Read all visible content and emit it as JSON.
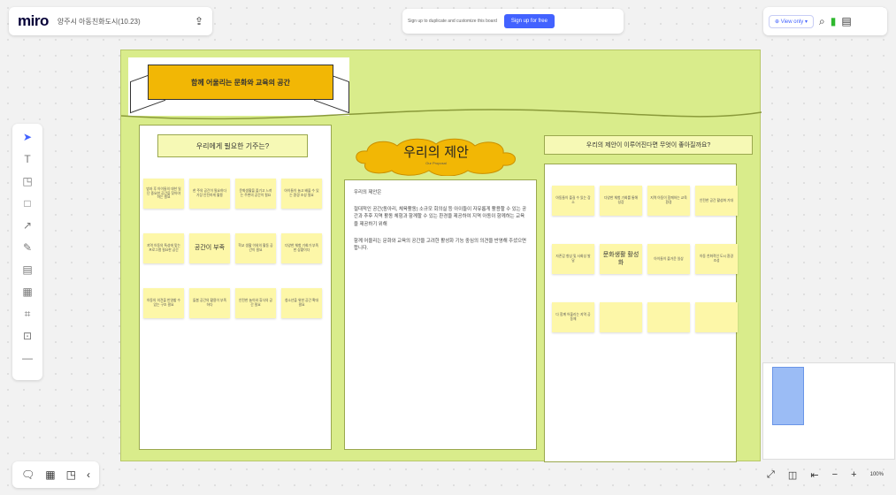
{
  "app": {
    "logo": "miro",
    "board_title": "양주시 아동친화도시(10.23)",
    "upload_icon": "upload-icon"
  },
  "signup": {
    "text": "Sign up to duplicate and customize this board",
    "button": "Sign up for free"
  },
  "top_right": {
    "view_only": "View only",
    "icons": [
      "search-icon",
      "timer-icon",
      "notes-icon"
    ]
  },
  "toolbar": {
    "tools": [
      {
        "name": "select-tool",
        "glyph": "➤",
        "active": true
      },
      {
        "name": "text-tool",
        "glyph": "T",
        "active": false
      },
      {
        "name": "sticky-note-tool",
        "glyph": "◳",
        "active": false
      },
      {
        "name": "shape-tool",
        "glyph": "□",
        "active": false
      },
      {
        "name": "connection-line-tool",
        "glyph": "↗",
        "active": false
      },
      {
        "name": "pen-tool",
        "glyph": "✎",
        "active": false
      },
      {
        "name": "comment-tool",
        "glyph": "▤",
        "active": false
      },
      {
        "name": "template-tool",
        "glyph": "▦",
        "active": false
      },
      {
        "name": "frame-tool",
        "glyph": "⌗",
        "active": false
      },
      {
        "name": "upload-tool",
        "glyph": "⊡",
        "active": false
      },
      {
        "name": "more-tools",
        "glyph": "—",
        "active": false
      }
    ]
  },
  "bottom_left": {
    "icons": [
      "comments-icon",
      "grid-icon",
      "sticky-icon",
      "chevron-icon"
    ],
    "glyphs": [
      "🗨",
      "▦",
      "◳",
      "‹"
    ]
  },
  "bottom_right": {
    "fit_icon": "expand-icon",
    "minimap_icon": "minimap-icon",
    "zoom_out": "−",
    "zoom_in": "+",
    "zoom_level": "100%"
  },
  "board": {
    "banner": "함께 어울리는 문화와 교육의 공간",
    "col1_title": "우리에게 필요한 기주는?",
    "col1_stickies": [
      "방과 후 아이들의 대한 일단 중요한 공간을 찾아야 하는 필요",
      "한 주의 공간이 필요하다 가장 안전하게 활용",
      "문화생활을 즐기고 느끼는 주변의 공간이 필요",
      "아이들이 놀고 배울 수 있는 환경 조성 필요",
      "지역 아동의 특성에 맞는 프로그램 필요한 공간",
      "공간이 부족",
      "학교 생활 이외의 활동 공간이 필요",
      "다양한 체험 기회가 부족한 상황이다",
      "아동의 의견을 반영할 수 있는 구조 필요",
      "돌봄 공간의 활용이 부족하다",
      "안전한 놀이와 휴식의 공간 필요",
      "청소년을 위한 공간 확대 필요"
    ],
    "cloud_title": "우리의 제안",
    "cloud_sub": "Our Proposal",
    "col2_heading": "우리의 제안은",
    "col2_p1": "절대적인 공간(동아리, 체육활동) 소규모 회의실 등 아이들이 자유롭게 활용할 수 있는 공간과 추후 지역 활동 체험과 함께할 수 있는 환경을 제공하여 지역 아동이 함께하는 교육을 제공하기 위해",
    "col2_p2": "함께 어울리는 문화와 교육의 공간을 고려한 활성화 기능 중심의 의견을 반영해 주셨으면 합니다.",
    "col3_title": "우리의 제안이 이루어진다면 무엇이 좋아질까요?",
    "col3_stickies": [
      "아동들이 즐길 수 있는 장소",
      "다양한 체험 기회를 통해 성장",
      "지역 아동이 함께하는 교육 환경",
      "안전한 공간 활성화 기대",
      "자존감 향상 및 사회성 발달",
      "문화생활 활성화",
      "아이들이 즐거운 일상",
      "아동 친화적인 도시 환경 조성",
      "다 함께 어울리는 지역 공동체",
      "",
      "",
      ""
    ]
  },
  "colors": {
    "accent": "#4262ff",
    "board": "#d9ec8b",
    "sticky": "#fdf7a8",
    "banner": "#f2b705"
  }
}
